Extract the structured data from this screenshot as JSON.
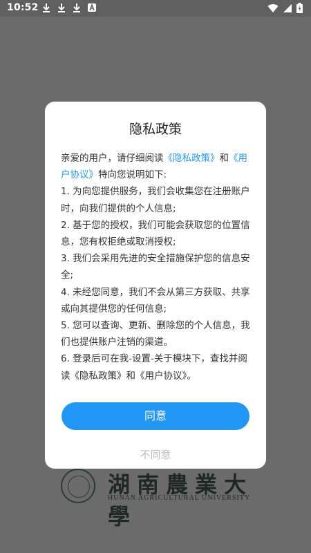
{
  "status_bar": {
    "time": "10:52",
    "left_icons": [
      "download-icon",
      "download-icon",
      "download-icon",
      "a-icon"
    ],
    "right_icons": [
      "wifi-icon",
      "signal-icon",
      "battery-icon"
    ]
  },
  "background_logo": {
    "name_cn": "湖南農業大學",
    "name_en": "HUNAN AGRICULTURAL UNIVERSITY"
  },
  "dialog": {
    "title": "隐私政策",
    "intro_prefix": "亲爱的用户，请仔细阅读",
    "privacy_link": "《隐私政策》",
    "and_text": "和",
    "agreement_link": "《用户协议》",
    "intro_suffix": "特向您说明如下:",
    "items": [
      "1. 为向您提供服务，我们会收集您在注册账户时，向我们提供的个人信息;",
      "2. 基于您的授权，我们可能会获取您的位置信息，您有权拒绝或取消授权;",
      "3. 我们会采用先进的安全措施保护您的信息安全;",
      "4. 未经您同意，我们不会从第三方获取、共享或向其提供您的任何信息;",
      "5. 您可以查询、更新、删除您的个人信息，我们也提供账户注销的渠道。",
      "6. 登录后可在我-设置-关于模块下，查找并阅读《隐私政策》和《用户协议》。"
    ],
    "agree_label": "同意",
    "disagree_label": "不同意"
  },
  "colors": {
    "accent": "#2196f3",
    "overlay": "#6b6b6b",
    "disabled_text": "#bdbdbd"
  }
}
